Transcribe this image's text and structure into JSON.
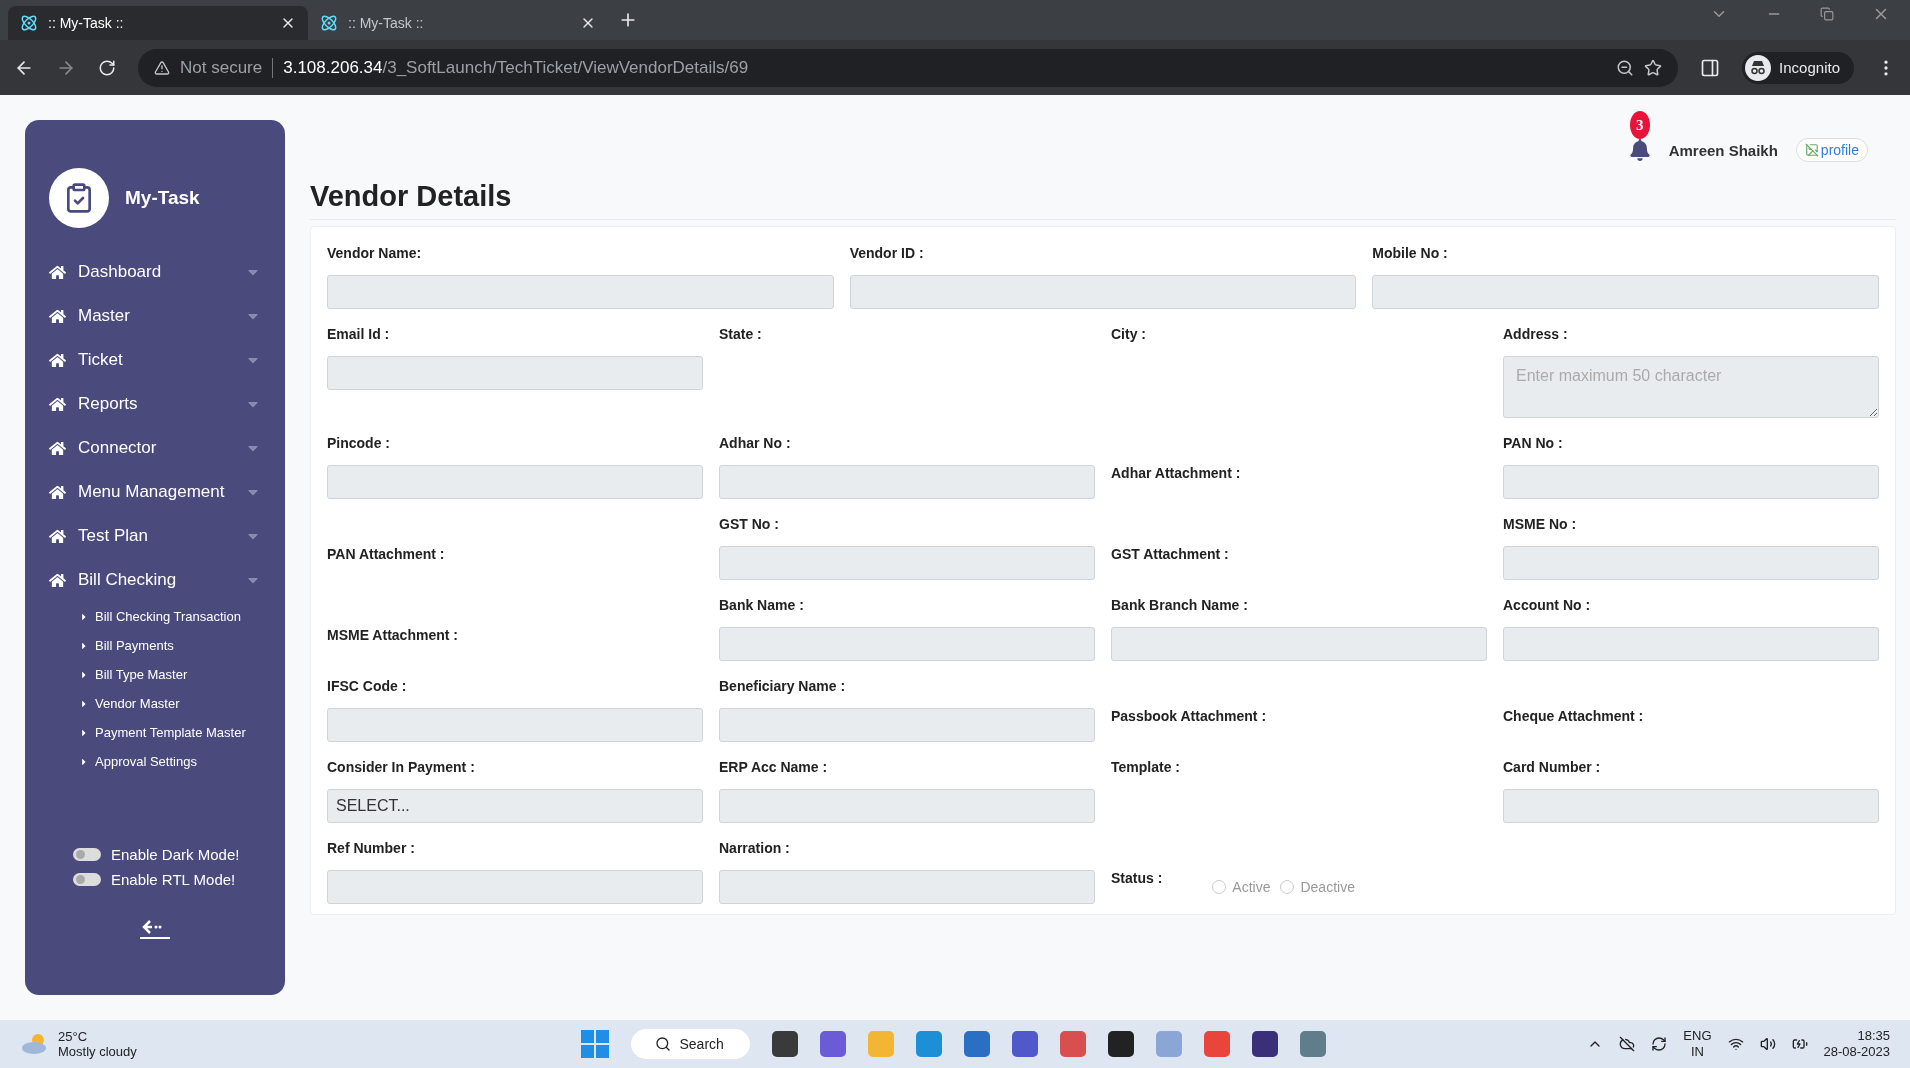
{
  "browser": {
    "tabs": [
      {
        "title": ":: My-Task ::",
        "selected": true
      },
      {
        "title": ":: My-Task ::",
        "selected": false
      }
    ],
    "security": "Not secure",
    "url_host": "3.108.206.34",
    "url_path": "/3_SoftLaunch/TechTicket/ViewVendorDetails/69",
    "profile": "Incognito"
  },
  "sidebar": {
    "brand": "My-Task",
    "items": [
      {
        "label": "Dashboard"
      },
      {
        "label": "Master"
      },
      {
        "label": "Ticket"
      },
      {
        "label": "Reports"
      },
      {
        "label": "Connector"
      },
      {
        "label": "Menu Management"
      },
      {
        "label": "Test Plan"
      },
      {
        "label": "Bill Checking",
        "children": [
          {
            "label": "Bill Checking Transaction"
          },
          {
            "label": "Bill Payments"
          },
          {
            "label": "Bill Type Master"
          },
          {
            "label": "Vendor Master"
          },
          {
            "label": "Payment Template Master"
          },
          {
            "label": "Approval Settings"
          }
        ]
      }
    ],
    "toggles": [
      {
        "label": "Enable Dark Mode!",
        "on": false
      },
      {
        "label": "Enable RTL Mode!",
        "on": false
      }
    ]
  },
  "header": {
    "notification_count": "3",
    "user_name": "Amreen Shaikh",
    "avatar_alt": "profile"
  },
  "title": "Vendor Details",
  "form": {
    "rows": [
      [
        {
          "kind": "input",
          "label": "Vendor Name:"
        },
        {
          "kind": "input",
          "label": "Vendor ID :"
        },
        {
          "kind": "input",
          "label": "Mobile No :"
        }
      ],
      [
        {
          "kind": "input",
          "label": "Email Id :"
        },
        {
          "kind": "label",
          "label": "State :"
        },
        {
          "kind": "label",
          "label": "City :"
        },
        {
          "kind": "textarea",
          "label": "Address :",
          "placeholder": "Enter maximum 50 character"
        }
      ],
      [
        {
          "kind": "input",
          "label": "Pincode :"
        },
        {
          "kind": "input",
          "label": "Adhar No :"
        },
        {
          "kind": "attachment",
          "label": "Adhar Attachment :"
        },
        {
          "kind": "input",
          "label": "PAN No :"
        }
      ],
      [
        {
          "kind": "attachment",
          "label": "PAN Attachment :"
        },
        {
          "kind": "input",
          "label": "GST No :"
        },
        {
          "kind": "attachment",
          "label": "GST Attachment :"
        },
        {
          "kind": "input",
          "label": "MSME No :"
        }
      ],
      [
        {
          "kind": "attachment",
          "label": "MSME Attachment :"
        },
        {
          "kind": "input",
          "label": "Bank Name :"
        },
        {
          "kind": "input",
          "label": "Bank Branch Name :"
        },
        {
          "kind": "input",
          "label": "Account No :"
        }
      ],
      [
        {
          "kind": "input",
          "label": "IFSC Code :"
        },
        {
          "kind": "input",
          "label": "Beneficiary Name :"
        },
        {
          "kind": "attachment",
          "label": "Passbook Attachment :"
        },
        {
          "kind": "attachment",
          "label": "Cheque Attachment :"
        }
      ],
      [
        {
          "kind": "select",
          "label": "Consider In Payment :",
          "value": "SELECT..."
        },
        {
          "kind": "input",
          "label": "ERP Acc Name :"
        },
        {
          "kind": "label",
          "label": "Template :"
        },
        {
          "kind": "input",
          "label": "Card Number :"
        }
      ],
      [
        {
          "kind": "input",
          "label": "Ref Number :"
        },
        {
          "kind": "input",
          "label": "Narration :"
        },
        {
          "kind": "radio",
          "label": "Status :",
          "options": [
            {
              "label": "Active",
              "selected": false
            },
            {
              "label": "Deactive",
              "selected": false
            }
          ]
        }
      ]
    ]
  },
  "taskbar": {
    "temperature": "25°C",
    "weather": "Mostly cloudy",
    "search": "Search",
    "lang": "ENG",
    "region": "IN",
    "time": "18:35",
    "date": "28-08-2023"
  }
}
